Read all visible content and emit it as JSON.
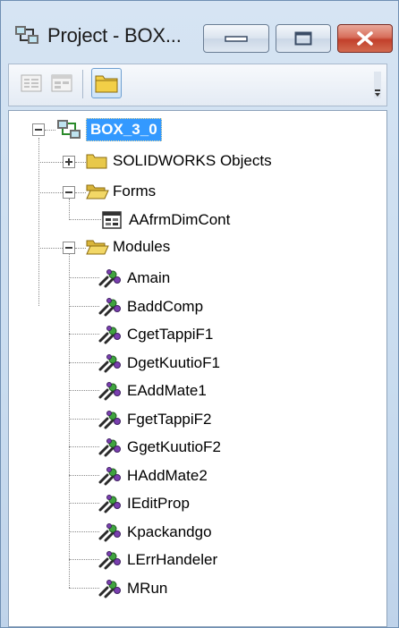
{
  "window": {
    "title": "Project - BOX..."
  },
  "tree": {
    "root": "BOX_3_0",
    "folders": [
      {
        "label": "SOLIDWORKS Objects",
        "expanded": false
      },
      {
        "label": "Forms",
        "expanded": true
      },
      {
        "label": "Modules",
        "expanded": true
      }
    ],
    "forms": [
      "AAfrmDimCont"
    ],
    "modules": [
      "Amain",
      "BaddComp",
      "CgetTappiF1",
      "DgetKuutioF1",
      "EAddMate1",
      "FgetTappiF2",
      "GgetKuutioF2",
      "HAddMate2",
      "IEditProp",
      "Kpackandgo",
      "LErrHandeler",
      "MRun"
    ]
  },
  "colors": {
    "selection": "#3399ff",
    "close_button": "#c2402b",
    "folder": "#e8c84a"
  }
}
